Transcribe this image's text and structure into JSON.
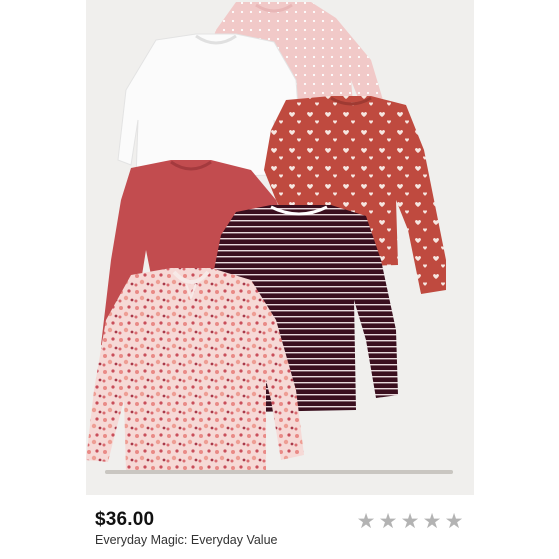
{
  "product": {
    "price": "$36.00",
    "tagline": "Everyday Magic: Everyday Value",
    "rating": 0,
    "rating_max": 5
  },
  "image": {
    "description_icons": [
      "pink-dot-shirt",
      "white-shirt",
      "red-heart-shirt",
      "rust-solid-shirt",
      "maroon-stripe-shirt",
      "pink-floral-shirt"
    ]
  },
  "colors": {
    "star_empty": "#b3b3b3",
    "price_text": "#111111",
    "image_bg": "#f0efed"
  }
}
